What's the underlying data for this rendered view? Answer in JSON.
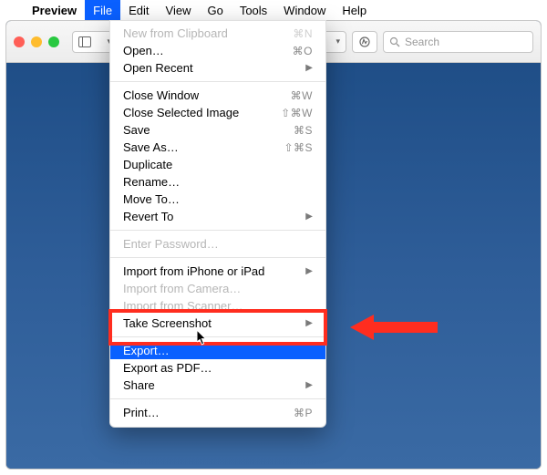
{
  "menubar": {
    "app": "Preview",
    "items": [
      "File",
      "Edit",
      "View",
      "Go",
      "Tools",
      "Window",
      "Help"
    ],
    "active_index": 0
  },
  "toolbar": {
    "search_placeholder": "Search"
  },
  "dropdown": {
    "groups": [
      [
        {
          "label": "New from Clipboard",
          "shortcut": "⌘N",
          "disabled": true
        },
        {
          "label": "Open…",
          "shortcut": "⌘O"
        },
        {
          "label": "Open Recent",
          "submenu": true
        }
      ],
      [
        {
          "label": "Close Window",
          "shortcut": "⌘W"
        },
        {
          "label": "Close Selected Image",
          "shortcut": "⇧⌘W"
        },
        {
          "label": "Save",
          "shortcut": "⌘S"
        },
        {
          "label": "Save As…",
          "shortcut": "⇧⌘S"
        },
        {
          "label": "Duplicate"
        },
        {
          "label": "Rename…"
        },
        {
          "label": "Move To…"
        },
        {
          "label": "Revert To",
          "submenu": true
        }
      ],
      [
        {
          "label": "Enter Password…",
          "disabled": true
        }
      ],
      [
        {
          "label": "Import from iPhone or iPad",
          "submenu": true
        },
        {
          "label": "Import from Camera…",
          "disabled": true
        },
        {
          "label": "Import from Scanner…",
          "disabled": true
        },
        {
          "label": "Take Screenshot",
          "submenu": true
        }
      ],
      [
        {
          "label": "Export…",
          "selected": true
        },
        {
          "label": "Export as PDF…"
        },
        {
          "label": "Share",
          "submenu": true
        }
      ],
      [
        {
          "label": "Print…",
          "shortcut": "⌘P"
        }
      ]
    ]
  }
}
